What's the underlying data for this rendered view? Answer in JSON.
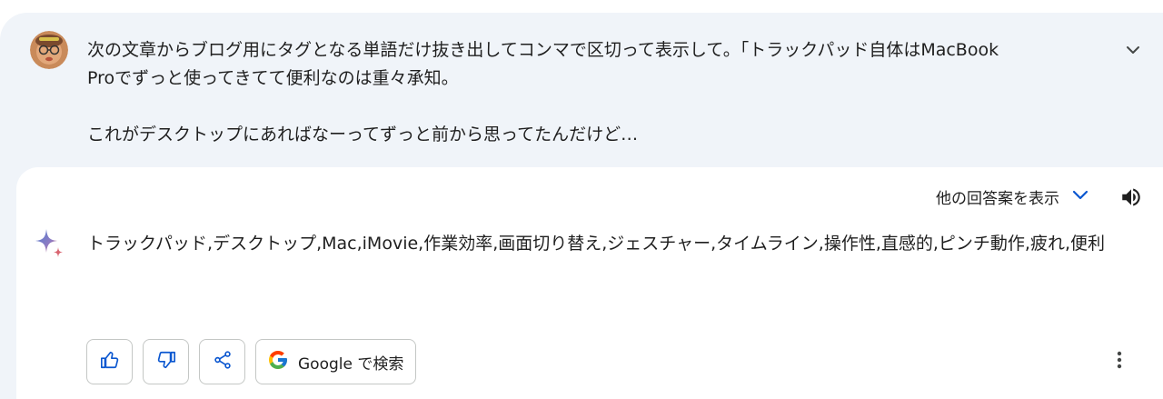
{
  "user": {
    "avatar": "avatar-photo",
    "message_line1": "次の文章からブログ用にタグとなる単語だけ抜き出してコンマで区切って表示して。「トラックパッド自体はMacBook",
    "message_line2": "Proでずっと使ってきてて便利なのは重々承知。",
    "message_line3": "これがデスクトップにあればなーってずっと前から思ってたんだけど…",
    "expand_icon": "chevron-down-icon"
  },
  "response": {
    "drafts_label": "他の回答案を表示",
    "answer_text": "トラックパッド,デスクトップ,Mac,iMovie,作業効率,画面切り替え,ジェスチャー,タイムライン,操作性,直感的,ピンチ動作,疲れ,便利",
    "speaker_icon": "speaker-icon",
    "sparkle_icon": "sparkle-icon"
  },
  "actions": {
    "thumb_up_icon": "thumb-up-icon",
    "thumb_down_icon": "thumb-down-icon",
    "share_icon": "share-icon",
    "google_label": "Google で検索",
    "more_icon": "more-vert-icon"
  },
  "colors": {
    "background": "#f0f4f9",
    "accent": "#0b57d0",
    "text": "#1f1f1f",
    "border": "#c4c7c5"
  }
}
